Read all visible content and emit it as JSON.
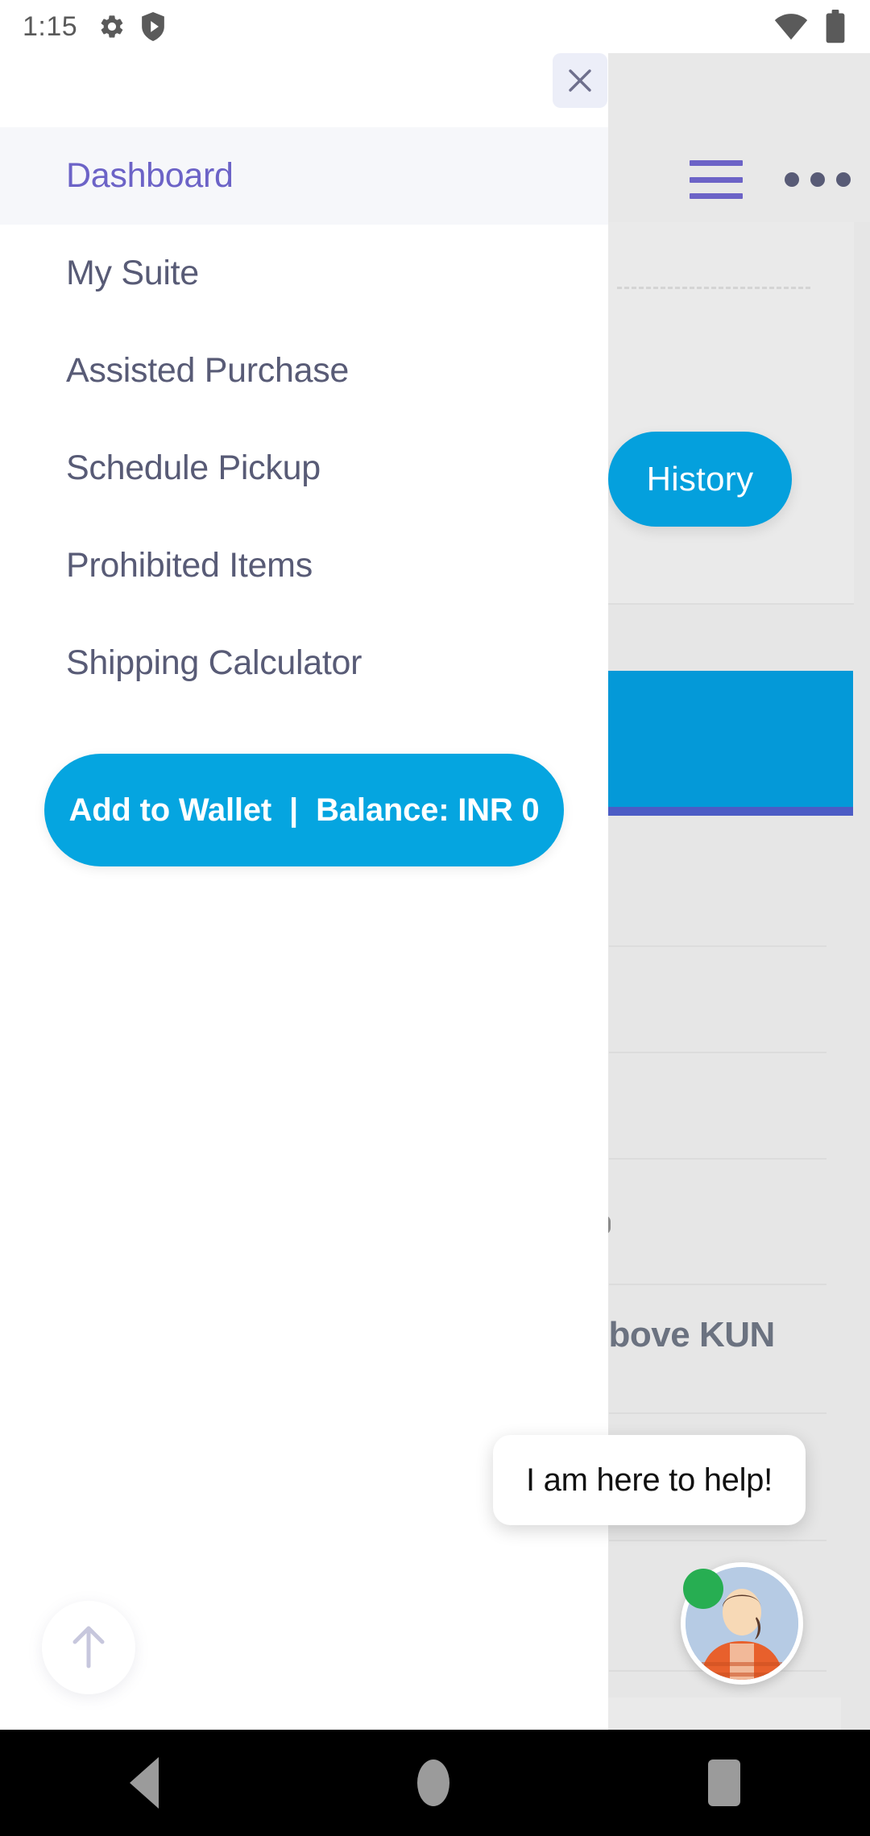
{
  "status_bar": {
    "time": "1:15",
    "icons": [
      "gear-icon",
      "shield-play-icon",
      "wifi-icon",
      "battery-icon"
    ]
  },
  "drawer": {
    "close_label": "close-icon",
    "menu_items": [
      {
        "label": "Dashboard",
        "active": true
      },
      {
        "label": "My Suite",
        "active": false
      },
      {
        "label": "Assisted Purchase",
        "active": false
      },
      {
        "label": "Schedule Pickup",
        "active": false
      },
      {
        "label": "Prohibited Items",
        "active": false
      },
      {
        "label": "Shipping Calculator",
        "active": false
      }
    ],
    "wallet_button": {
      "label": "Add to Wallet",
      "separator": "|",
      "balance": "Balance: INR 0"
    }
  },
  "background_app": {
    "header": {
      "menu_icon": "hamburger-icon",
      "overflow_icon": "overflow-menu-icon"
    },
    "history_button_label": "History",
    "partial_text": ": Above KUN"
  },
  "chat_widget": {
    "message": "I am here to help!",
    "status": "online"
  },
  "scroll_top": {
    "icon": "arrow-up-icon"
  },
  "nav_bar": {
    "back": "back-icon",
    "home": "home-icon",
    "recents": "recents-icon"
  },
  "colors": {
    "accent_blue": "#05a5e0",
    "accent_purple": "#6c63c7",
    "drawer_bg": "#ffffff",
    "app_bg": "#e6e6e6",
    "text_gray": "#585b76",
    "online_green": "#27ae52",
    "banner_underline": "#4c5cc5"
  }
}
